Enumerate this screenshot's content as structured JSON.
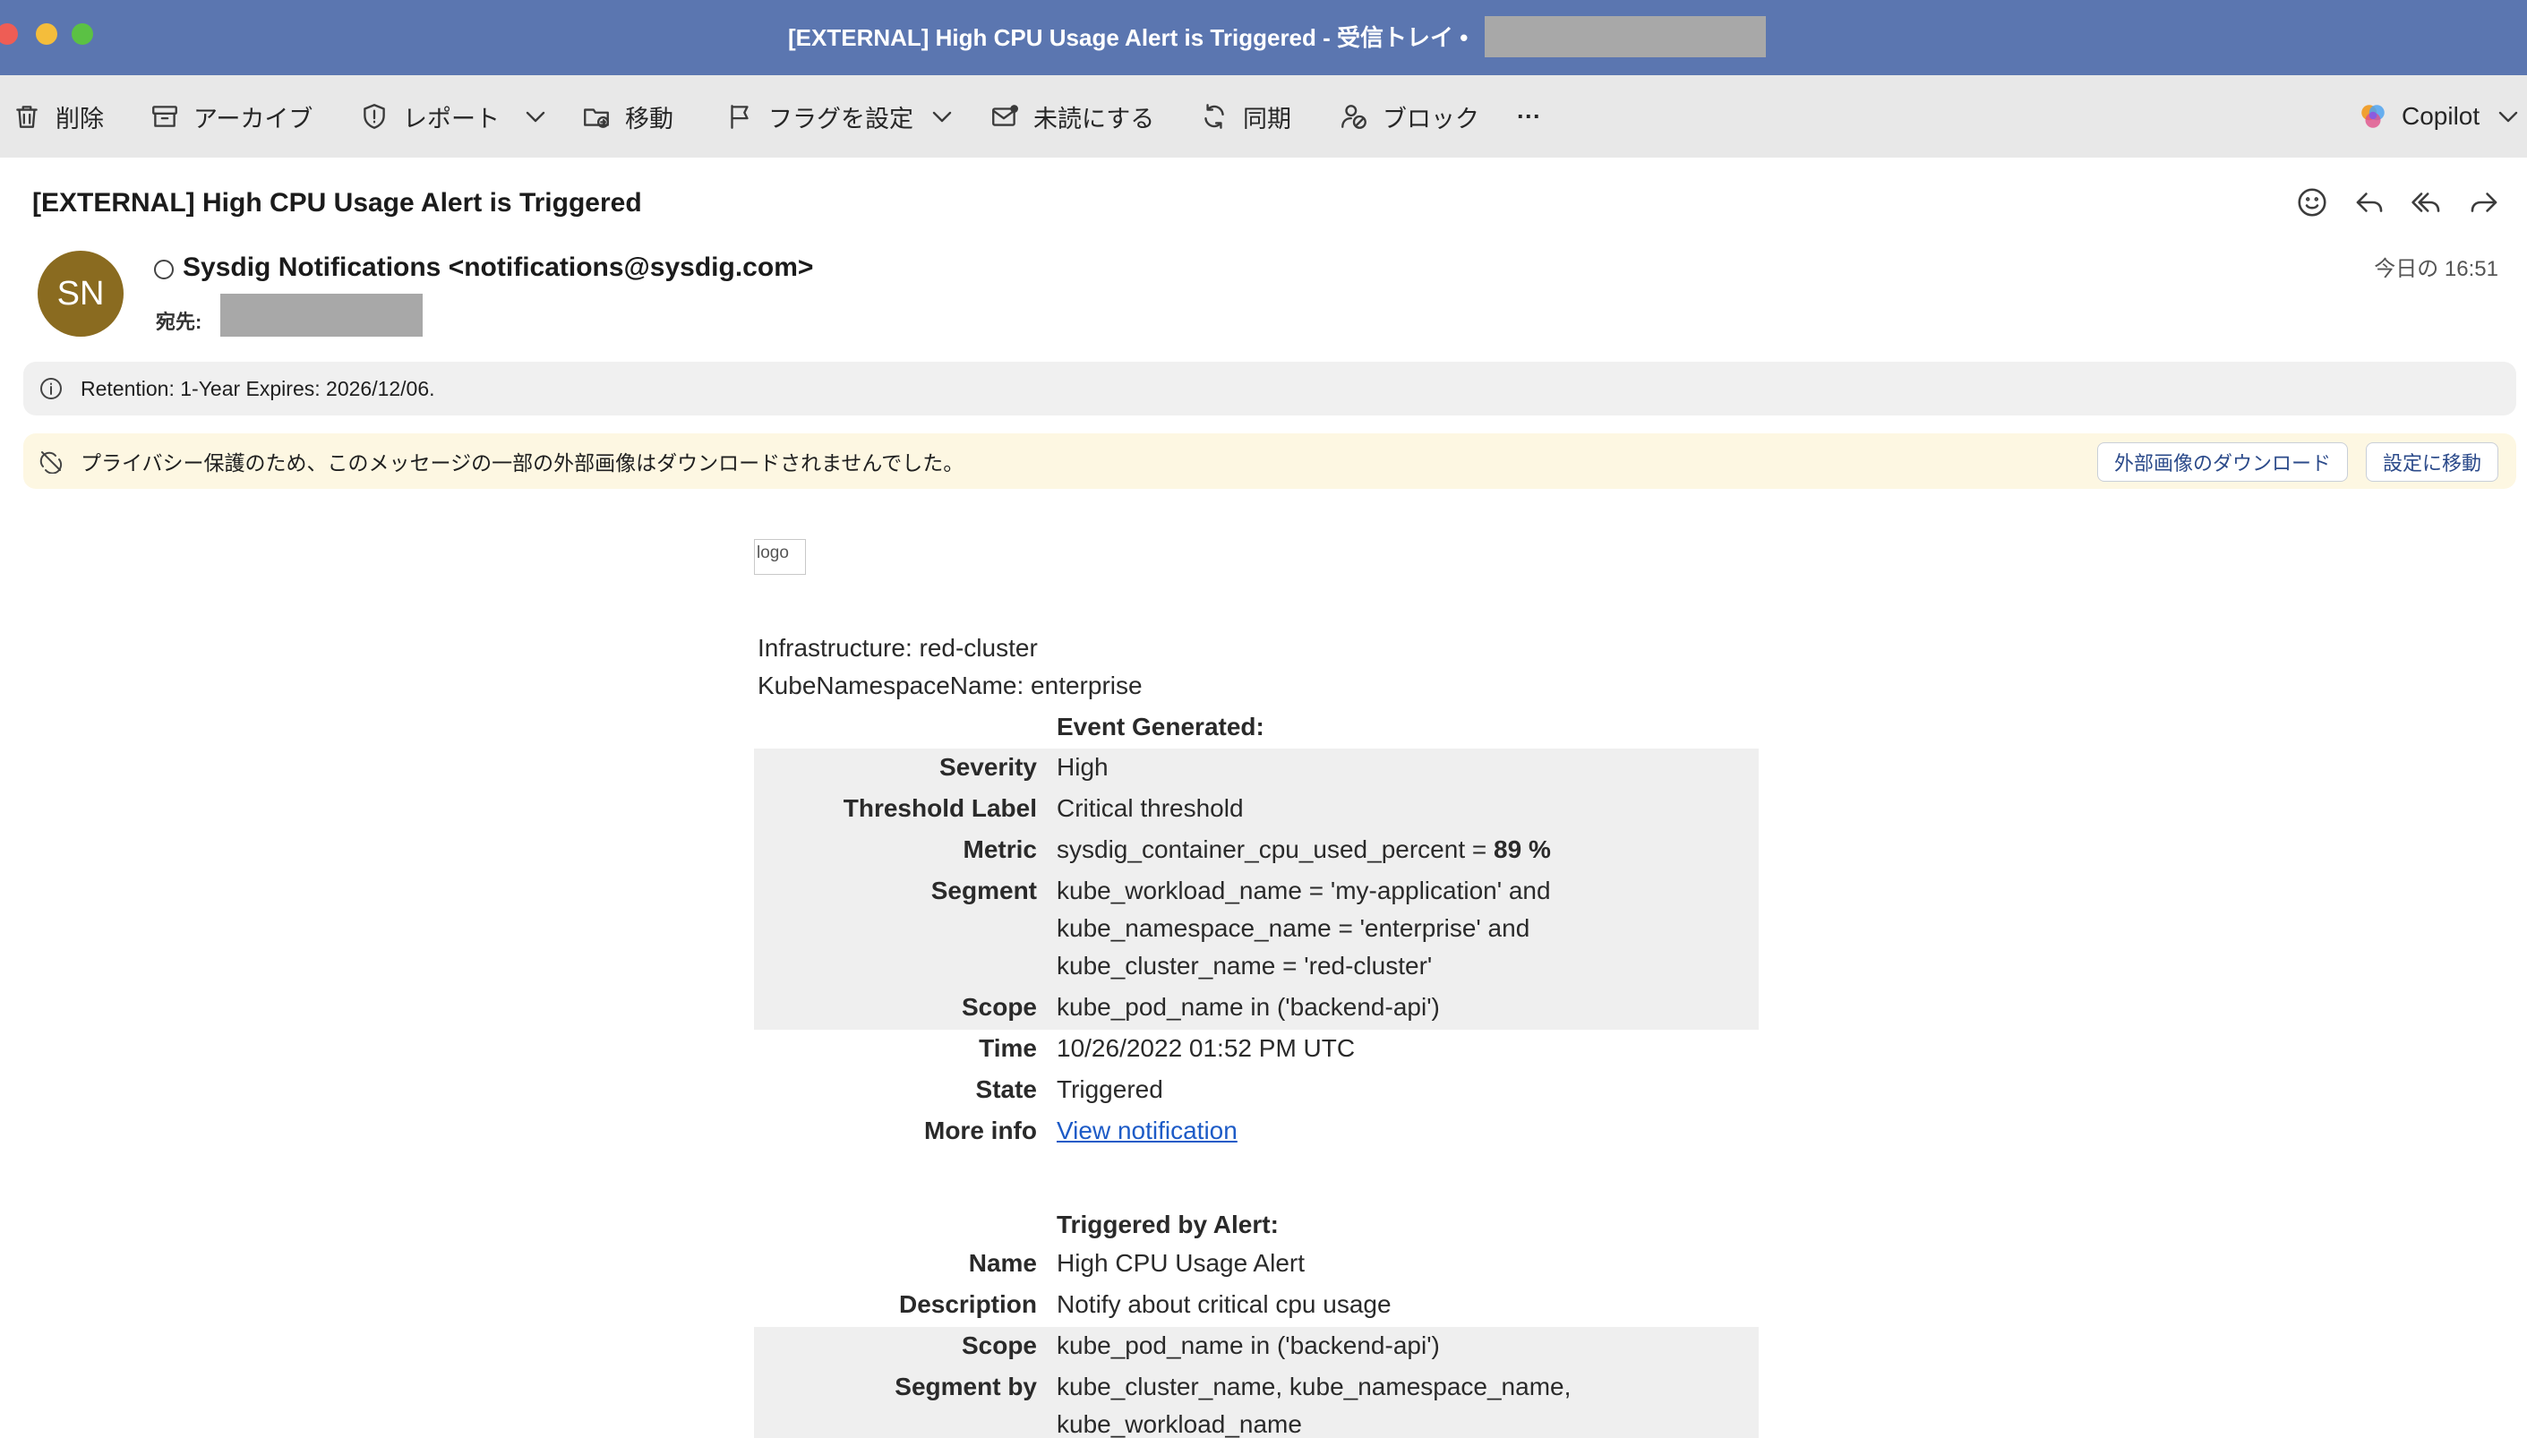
{
  "window": {
    "title": "[EXTERNAL] High CPU Usage Alert is Triggered - 受信トレイ •"
  },
  "toolbar": {
    "delete": "削除",
    "archive": "アーカイブ",
    "report": "レポート",
    "move": "移動",
    "flag": "フラグを設定",
    "mark_unread": "未読にする",
    "sync": "同期",
    "block": "ブロック",
    "more": "···",
    "copilot": "Copilot"
  },
  "message": {
    "subject": "[EXTERNAL] High CPU Usage Alert is Triggered",
    "avatar_initials": "SN",
    "avatar_color": "#8a6b20",
    "sender": "Sysdig Notifications <notifications@sysdig.com>",
    "to_label": "宛先:",
    "date": "今日の 16:51"
  },
  "banners": {
    "retention": "Retention: 1-Year Expires: 2026/12/06.",
    "privacy": "プライバシー保護のため、このメッセージの一部の外部画像はダウンロードされませんでした。",
    "download_button": "外部画像のダウンロード",
    "settings_button": "設定に移動"
  },
  "email_body": {
    "logo_alt": "logo",
    "infrastructure": "Infrastructure: red-cluster",
    "namespace": "KubeNamespaceName: enterprise",
    "event_heading": "Event Generated:",
    "event_rows": [
      {
        "label": "Severity",
        "value": "High"
      },
      {
        "label": "Threshold Label",
        "value": "Critical threshold"
      },
      {
        "label": "Metric",
        "value_prefix": "sysdig_container_cpu_used_percent = ",
        "value_bold": "89 %"
      },
      {
        "label": "Segment",
        "lines": [
          "kube_workload_name = 'my-application' and",
          "kube_namespace_name = 'enterprise' and",
          "kube_cluster_name = 'red-cluster'"
        ]
      },
      {
        "label": "Scope",
        "value": "kube_pod_name in ('backend-api')"
      },
      {
        "label": "Time",
        "value": "10/26/2022 01:52 PM UTC"
      },
      {
        "label": "State",
        "value": "Triggered"
      },
      {
        "label": "More info",
        "value": "View notification"
      }
    ],
    "alert_heading": "Triggered by Alert:",
    "alert_rows": [
      {
        "label": "Name",
        "value": "High CPU Usage Alert"
      },
      {
        "label": "Description",
        "value": "Notify about critical cpu usage"
      },
      {
        "label": "Scope",
        "value": "kube_pod_name in ('backend-api')"
      },
      {
        "label": "Segment by",
        "lines": [
          "kube_cluster_name, kube_namespace_name,",
          "kube_workload_name"
        ]
      }
    ]
  },
  "colors": {
    "titlebar": "#5b76b0",
    "toolbar": "#e8e8e8",
    "link": "#1d5bc7",
    "row_shade": "#efefef",
    "privacy_banner": "#fdf7e2"
  }
}
